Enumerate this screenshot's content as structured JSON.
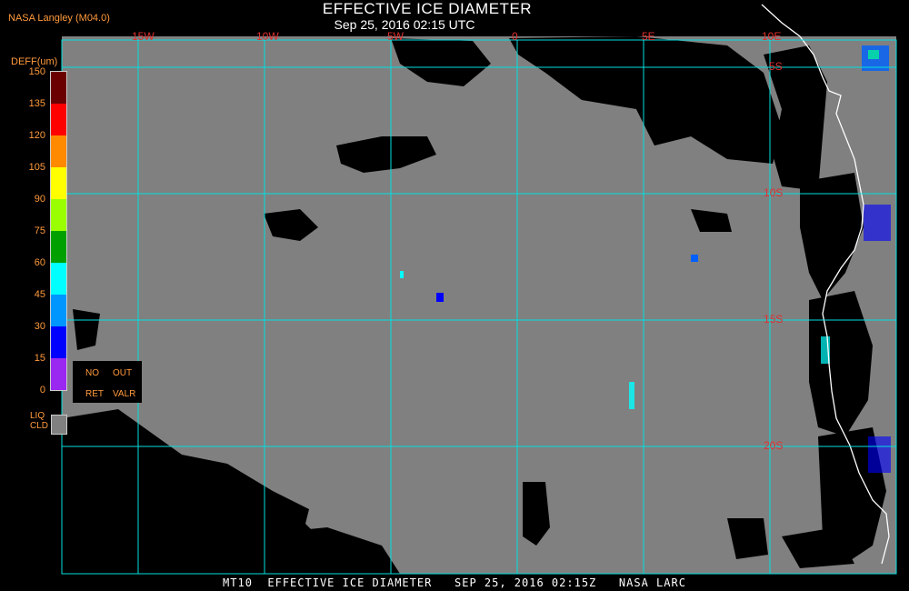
{
  "header": {
    "org": "NASA Langley (M04.0)",
    "title": "EFFECTIVE ICE DIAMETER",
    "subtitle": "Sep 25, 2016 02:15 UTC"
  },
  "footer": {
    "text": "MT10  EFFECTIVE ICE DIAMETER   SEP 25, 2016 02:15Z   NASA LARC"
  },
  "colorbar": {
    "title": "DEFF(um)",
    "ticks": [
      "150",
      "135",
      "120",
      "105",
      "90",
      "75",
      "60",
      "45",
      "30",
      "15",
      "0"
    ],
    "colors": [
      "#6a0000",
      "#ff0000",
      "#ff8a00",
      "#ffff00",
      "#9aff00",
      "#00a000",
      "#00ffff",
      "#0096ff",
      "#0000ff",
      "#9a28f0"
    ]
  },
  "legend": {
    "no": "NO",
    "ret": "RET",
    "out": "OUT",
    "valr": "VALR",
    "liq_line1": "LIQ",
    "liq_line2": "CLD"
  },
  "grid": {
    "longitudes": [
      "15W",
      "10W",
      "5W",
      "0",
      "5E",
      "10E"
    ],
    "latitudes": [
      "5S",
      "10S",
      "15S",
      "20S"
    ]
  },
  "colors": {
    "background_cloud": "#808080",
    "clear": "#000000",
    "grid": "#00e0e0",
    "coast": "#ffffff",
    "labels": "#ff9a3c",
    "grid_labels": "#e03030"
  }
}
